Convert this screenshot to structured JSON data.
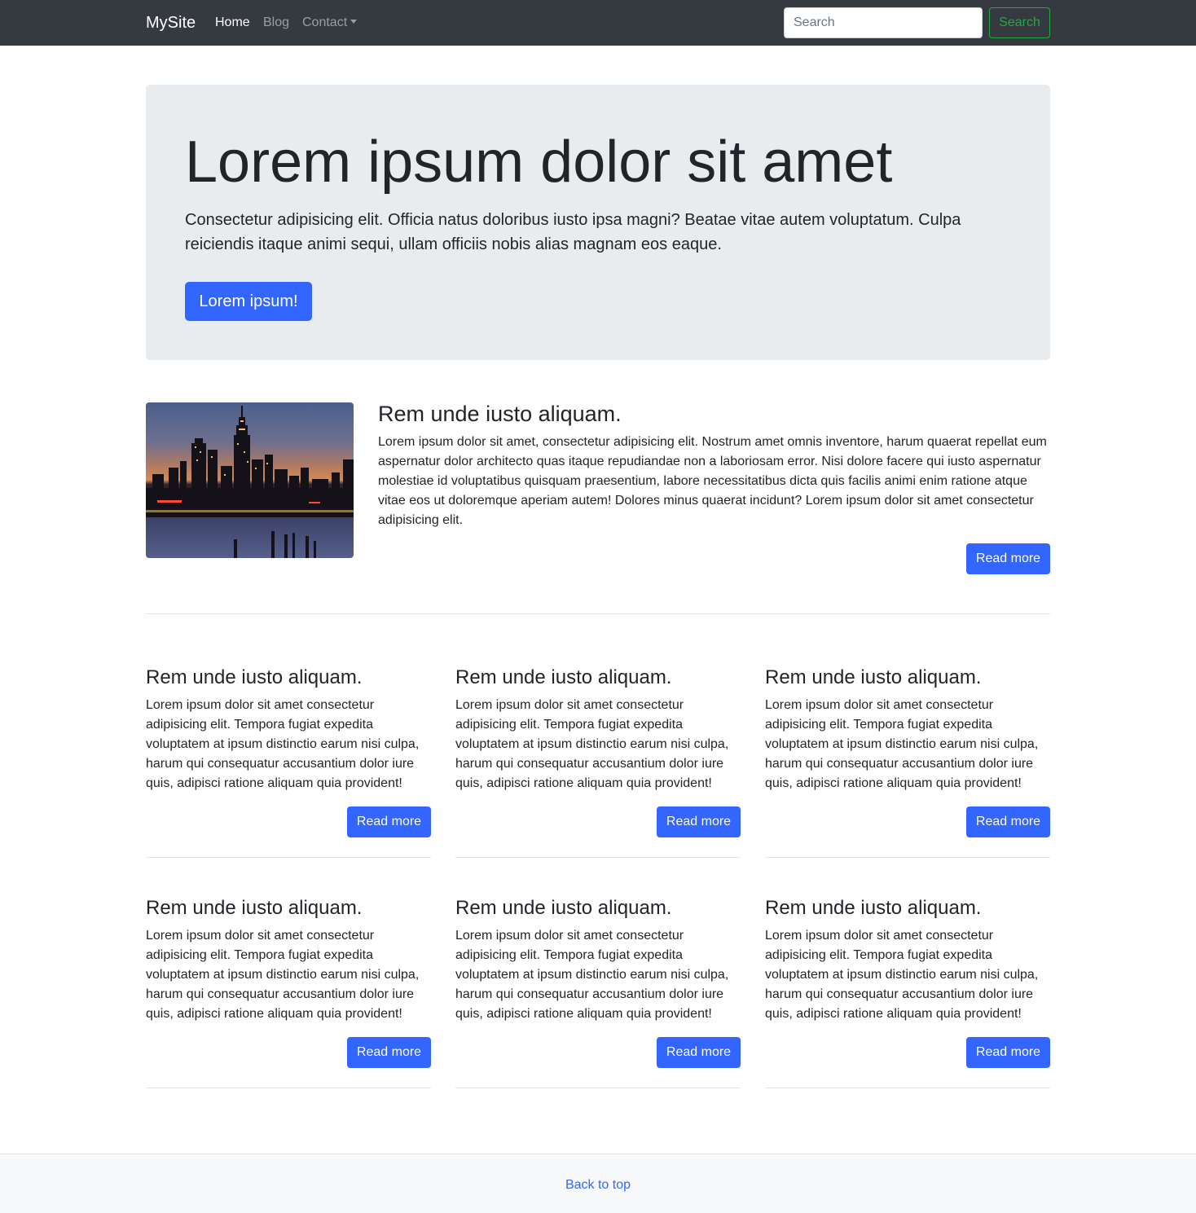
{
  "navbar": {
    "brand": "MySite",
    "links": [
      {
        "label": "Home",
        "active": true
      },
      {
        "label": "Blog",
        "active": false
      },
      {
        "label": "Contact",
        "active": false,
        "dropdown": true
      }
    ],
    "search": {
      "placeholder": "Search",
      "button_label": "Search"
    }
  },
  "hero": {
    "title": "Lorem ipsum dolor sit amet",
    "lead": "Consectetur adipisicing elit. Officia natus doloribus iusto ipsa magni? Beatae vitae autem voluptatum. Culpa reiciendis itaque animi sequi, ullam officiis nobis alias magnam eos eaque.",
    "button_label": "Lorem ipsum!"
  },
  "feature": {
    "image": "city-skyline-at-dusk",
    "title": "Rem unde iusto aliquam.",
    "text": "Lorem ipsum dolor sit amet, consectetur adipisicing elit. Nostrum amet omnis inventore, harum quaerat repellat eum aspernatur dolor architecto quas itaque repudiandae non a laboriosam error. Nisi dolore facere qui iusto aspernatur molestiae id voluptatibus quisquam praesentium, labore necessitatibus dicta quis facilis animi enim ratione atque vitae eos ut doloremque aperiam autem! Dolores minus quaerat incidunt? Lorem ipsum dolor sit amet consectetur adipisicing elit.",
    "button_label": "Read more"
  },
  "cards": [
    {
      "title": "Rem unde iusto aliquam.",
      "text": "Lorem ipsum dolor sit amet consectetur adipisicing elit. Tempora fugiat expedita voluptatem at ipsum distinctio earum nisi culpa, harum qui consequatur accusantium dolor iure quis, adipisci ratione aliquam quia provident!",
      "button_label": "Read more"
    },
    {
      "title": "Rem unde iusto aliquam.",
      "text": "Lorem ipsum dolor sit amet consectetur adipisicing elit. Tempora fugiat expedita voluptatem at ipsum distinctio earum nisi culpa, harum qui consequatur accusantium dolor iure quis, adipisci ratione aliquam quia provident!",
      "button_label": "Read more"
    },
    {
      "title": "Rem unde iusto aliquam.",
      "text": "Lorem ipsum dolor sit amet consectetur adipisicing elit. Tempora fugiat expedita voluptatem at ipsum distinctio earum nisi culpa, harum qui consequatur accusantium dolor iure quis, adipisci ratione aliquam quia provident!",
      "button_label": "Read more"
    },
    {
      "title": "Rem unde iusto aliquam.",
      "text": "Lorem ipsum dolor sit amet consectetur adipisicing elit. Tempora fugiat expedita voluptatem at ipsum distinctio earum nisi culpa, harum qui consequatur accusantium dolor iure quis, adipisci ratione aliquam quia provident!",
      "button_label": "Read more"
    },
    {
      "title": "Rem unde iusto aliquam.",
      "text": "Lorem ipsum dolor sit amet consectetur adipisicing elit. Tempora fugiat expedita voluptatem at ipsum distinctio earum nisi culpa, harum qui consequatur accusantium dolor iure quis, adipisci ratione aliquam quia provident!",
      "button_label": "Read more"
    },
    {
      "title": "Rem unde iusto aliquam.",
      "text": "Lorem ipsum dolor sit amet consectetur adipisicing elit. Tempora fugiat expedita voluptatem at ipsum distinctio earum nisi culpa, harum qui consequatur accusantium dolor iure quis, adipisci ratione aliquam quia provident!",
      "button_label": "Read more"
    }
  ],
  "footer": {
    "back_to_top": "Back to top"
  },
  "colors": {
    "navbar_bg": "#343a40",
    "primary": "#3366ff",
    "success": "#28a745",
    "jumbotron_bg": "#e9ecef",
    "footer_bg": "#f8f9fa"
  }
}
